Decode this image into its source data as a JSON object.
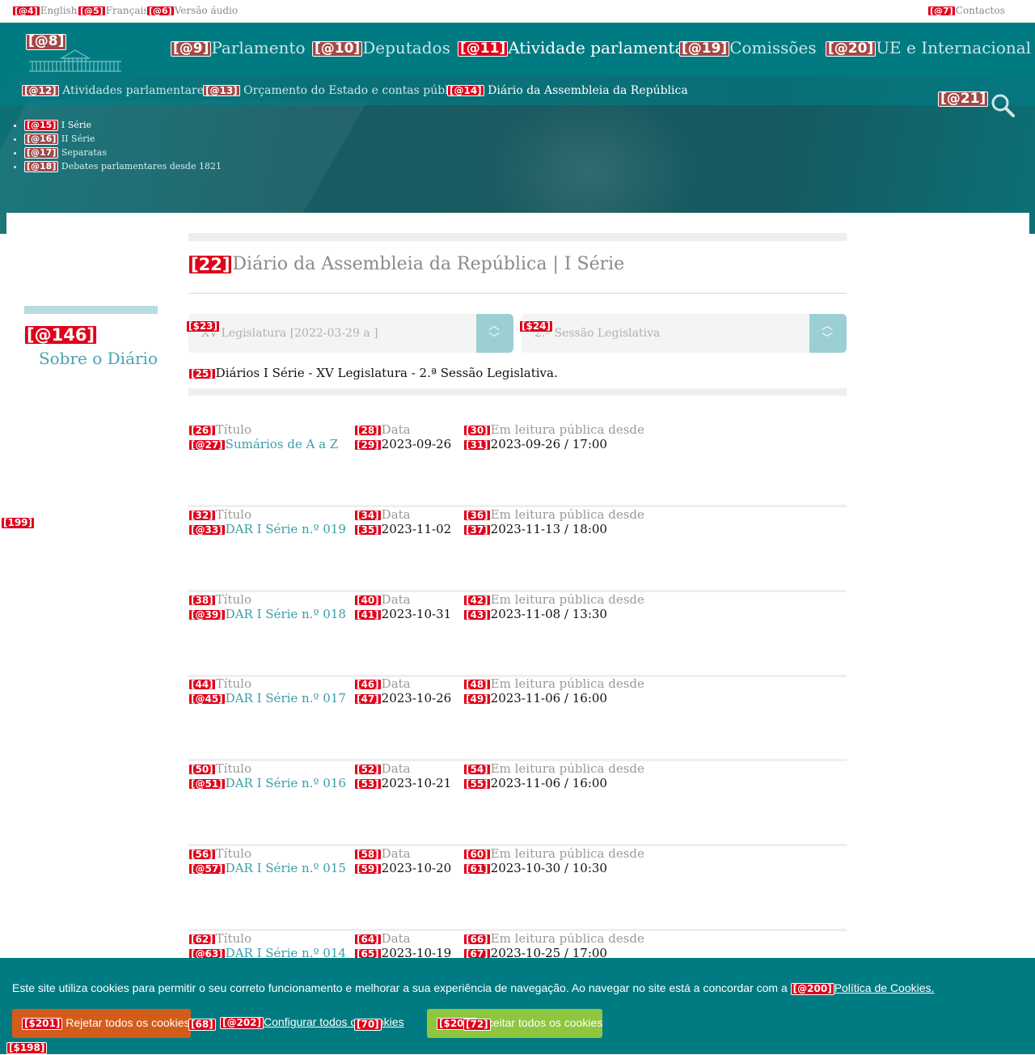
{
  "util": {
    "english": {
      "tag": "[@4]",
      "label": "English"
    },
    "francais": {
      "tag": "[@5]",
      "label": "Français"
    },
    "audio": {
      "tag": "[@6]",
      "label": "Versão áudio"
    },
    "contactos": {
      "tag": "[@7]",
      "label": "Contactos"
    }
  },
  "logo": {
    "tag": "[@8]",
    "icon": "parliament-building-logo"
  },
  "nav": [
    {
      "tag": "[@9]",
      "label": "Parlamento"
    },
    {
      "tag": "[@10]",
      "label": "Deputados"
    },
    {
      "tag": "[@11]",
      "label": "Atividade parlamentar"
    },
    {
      "tag": "[@19]",
      "label": "Comissões"
    },
    {
      "tag": "[@20]",
      "label": "UE e Internacional"
    }
  ],
  "subnav": [
    {
      "tag": "[@12]",
      "label": "Atividades parlamentares"
    },
    {
      "tag": "[@13]",
      "label": "Orçamento do Estado e contas públicas"
    },
    {
      "tag": "[@14]",
      "label": "Diário da Assembleia da República"
    }
  ],
  "search": {
    "tag": "[@21]",
    "icon": "search-icon"
  },
  "sublist": [
    {
      "tag": "[@15]",
      "label": "I Série"
    },
    {
      "tag": "[@16]",
      "label": "II Série"
    },
    {
      "tag": "[@17]",
      "label": "Separatas"
    },
    {
      "tag": "[@18]",
      "label": "Debates parlamentares desde 1821"
    }
  ],
  "page": {
    "title_tag": "[22]",
    "title": "Diário da Assembleia da República | I Série",
    "aside_tag": "[@146]",
    "aside_link": "Sobre o Diário",
    "side_marker": "[199]",
    "select1": {
      "tag": "[$23]",
      "value": "XV Legislatura [2022-03-29 a ]"
    },
    "select2": {
      "tag": "[$24]",
      "value": "2.ª Sessão Legislativa"
    },
    "info_tag": "[25]",
    "info": "Diários I Série - XV Legislatura - 2.ª Sessão Legislativa."
  },
  "labels": {
    "titulo": "Título",
    "data": "Data",
    "leitura": "Em leitura pública desde"
  },
  "rows": [
    {
      "t1": "[26]",
      "t2": "[@27]",
      "title": "Sumários de A a Z",
      "t3": "[28]",
      "t4": "[29]",
      "date": "2023-09-26",
      "t5": "[30]",
      "t6": "[31]",
      "since": "2023-09-26 / 17:00"
    },
    {
      "t1": "[32]",
      "t2": "[@33]",
      "title": "DAR I Série n.º 019",
      "t3": "[34]",
      "t4": "[35]",
      "date": "2023-11-02",
      "t5": "[36]",
      "t6": "[37]",
      "since": "2023-11-13 / 18:00"
    },
    {
      "t1": "[38]",
      "t2": "[@39]",
      "title": "DAR I Série n.º 018",
      "t3": "[40]",
      "t4": "[41]",
      "date": "2023-10-31",
      "t5": "[42]",
      "t6": "[43]",
      "since": "2023-11-08 / 13:30"
    },
    {
      "t1": "[44]",
      "t2": "[@45]",
      "title": "DAR I Série n.º 017",
      "t3": "[46]",
      "t4": "[47]",
      "date": "2023-10-26",
      "t5": "[48]",
      "t6": "[49]",
      "since": "2023-11-06 / 16:00"
    },
    {
      "t1": "[50]",
      "t2": "[@51]",
      "title": "DAR I Série n.º 016",
      "t3": "[52]",
      "t4": "[53]",
      "date": "2023-10-21",
      "t5": "[54]",
      "t6": "[55]",
      "since": "2023-11-06 / 16:00"
    },
    {
      "t1": "[56]",
      "t2": "[@57]",
      "title": "DAR I Série n.º 015",
      "t3": "[58]",
      "t4": "[59]",
      "date": "2023-10-20",
      "t5": "[60]",
      "t6": "[61]",
      "since": "2023-10-30 / 10:30"
    },
    {
      "t1": "[62]",
      "t2": "[@63]",
      "title": "DAR I Série n.º 014",
      "t3": "[64]",
      "t4": "[65]",
      "date": "2023-10-19",
      "t5": "[66]",
      "t6": "[67]",
      "since": "2023-10-25 / 17:00"
    }
  ],
  "cookie": {
    "message": "Este site utiliza cookies para permitir o seu correto funcionamento e melhorar a sua experiência de navegação. Ao navegar no site está a concordar com a",
    "policy_tag": "[@200]",
    "policy": "Política de Cookies.",
    "reject_tag": "[$201]",
    "reject": "Rejetar todos os cookies",
    "config_tag": "[@202]",
    "config": "Configurar todos os cookies",
    "accept_tag": "[$203]",
    "accept": "Aceitar todos os cookies",
    "overlap_tags": [
      "[68]",
      "[70]",
      "[72]"
    ],
    "bottom_tag": "[$198]"
  },
  "colors": {
    "nav": "#007b82",
    "accent": "#3a9ea8",
    "reject": "#d35c1a",
    "accept": "#8dc63f"
  }
}
